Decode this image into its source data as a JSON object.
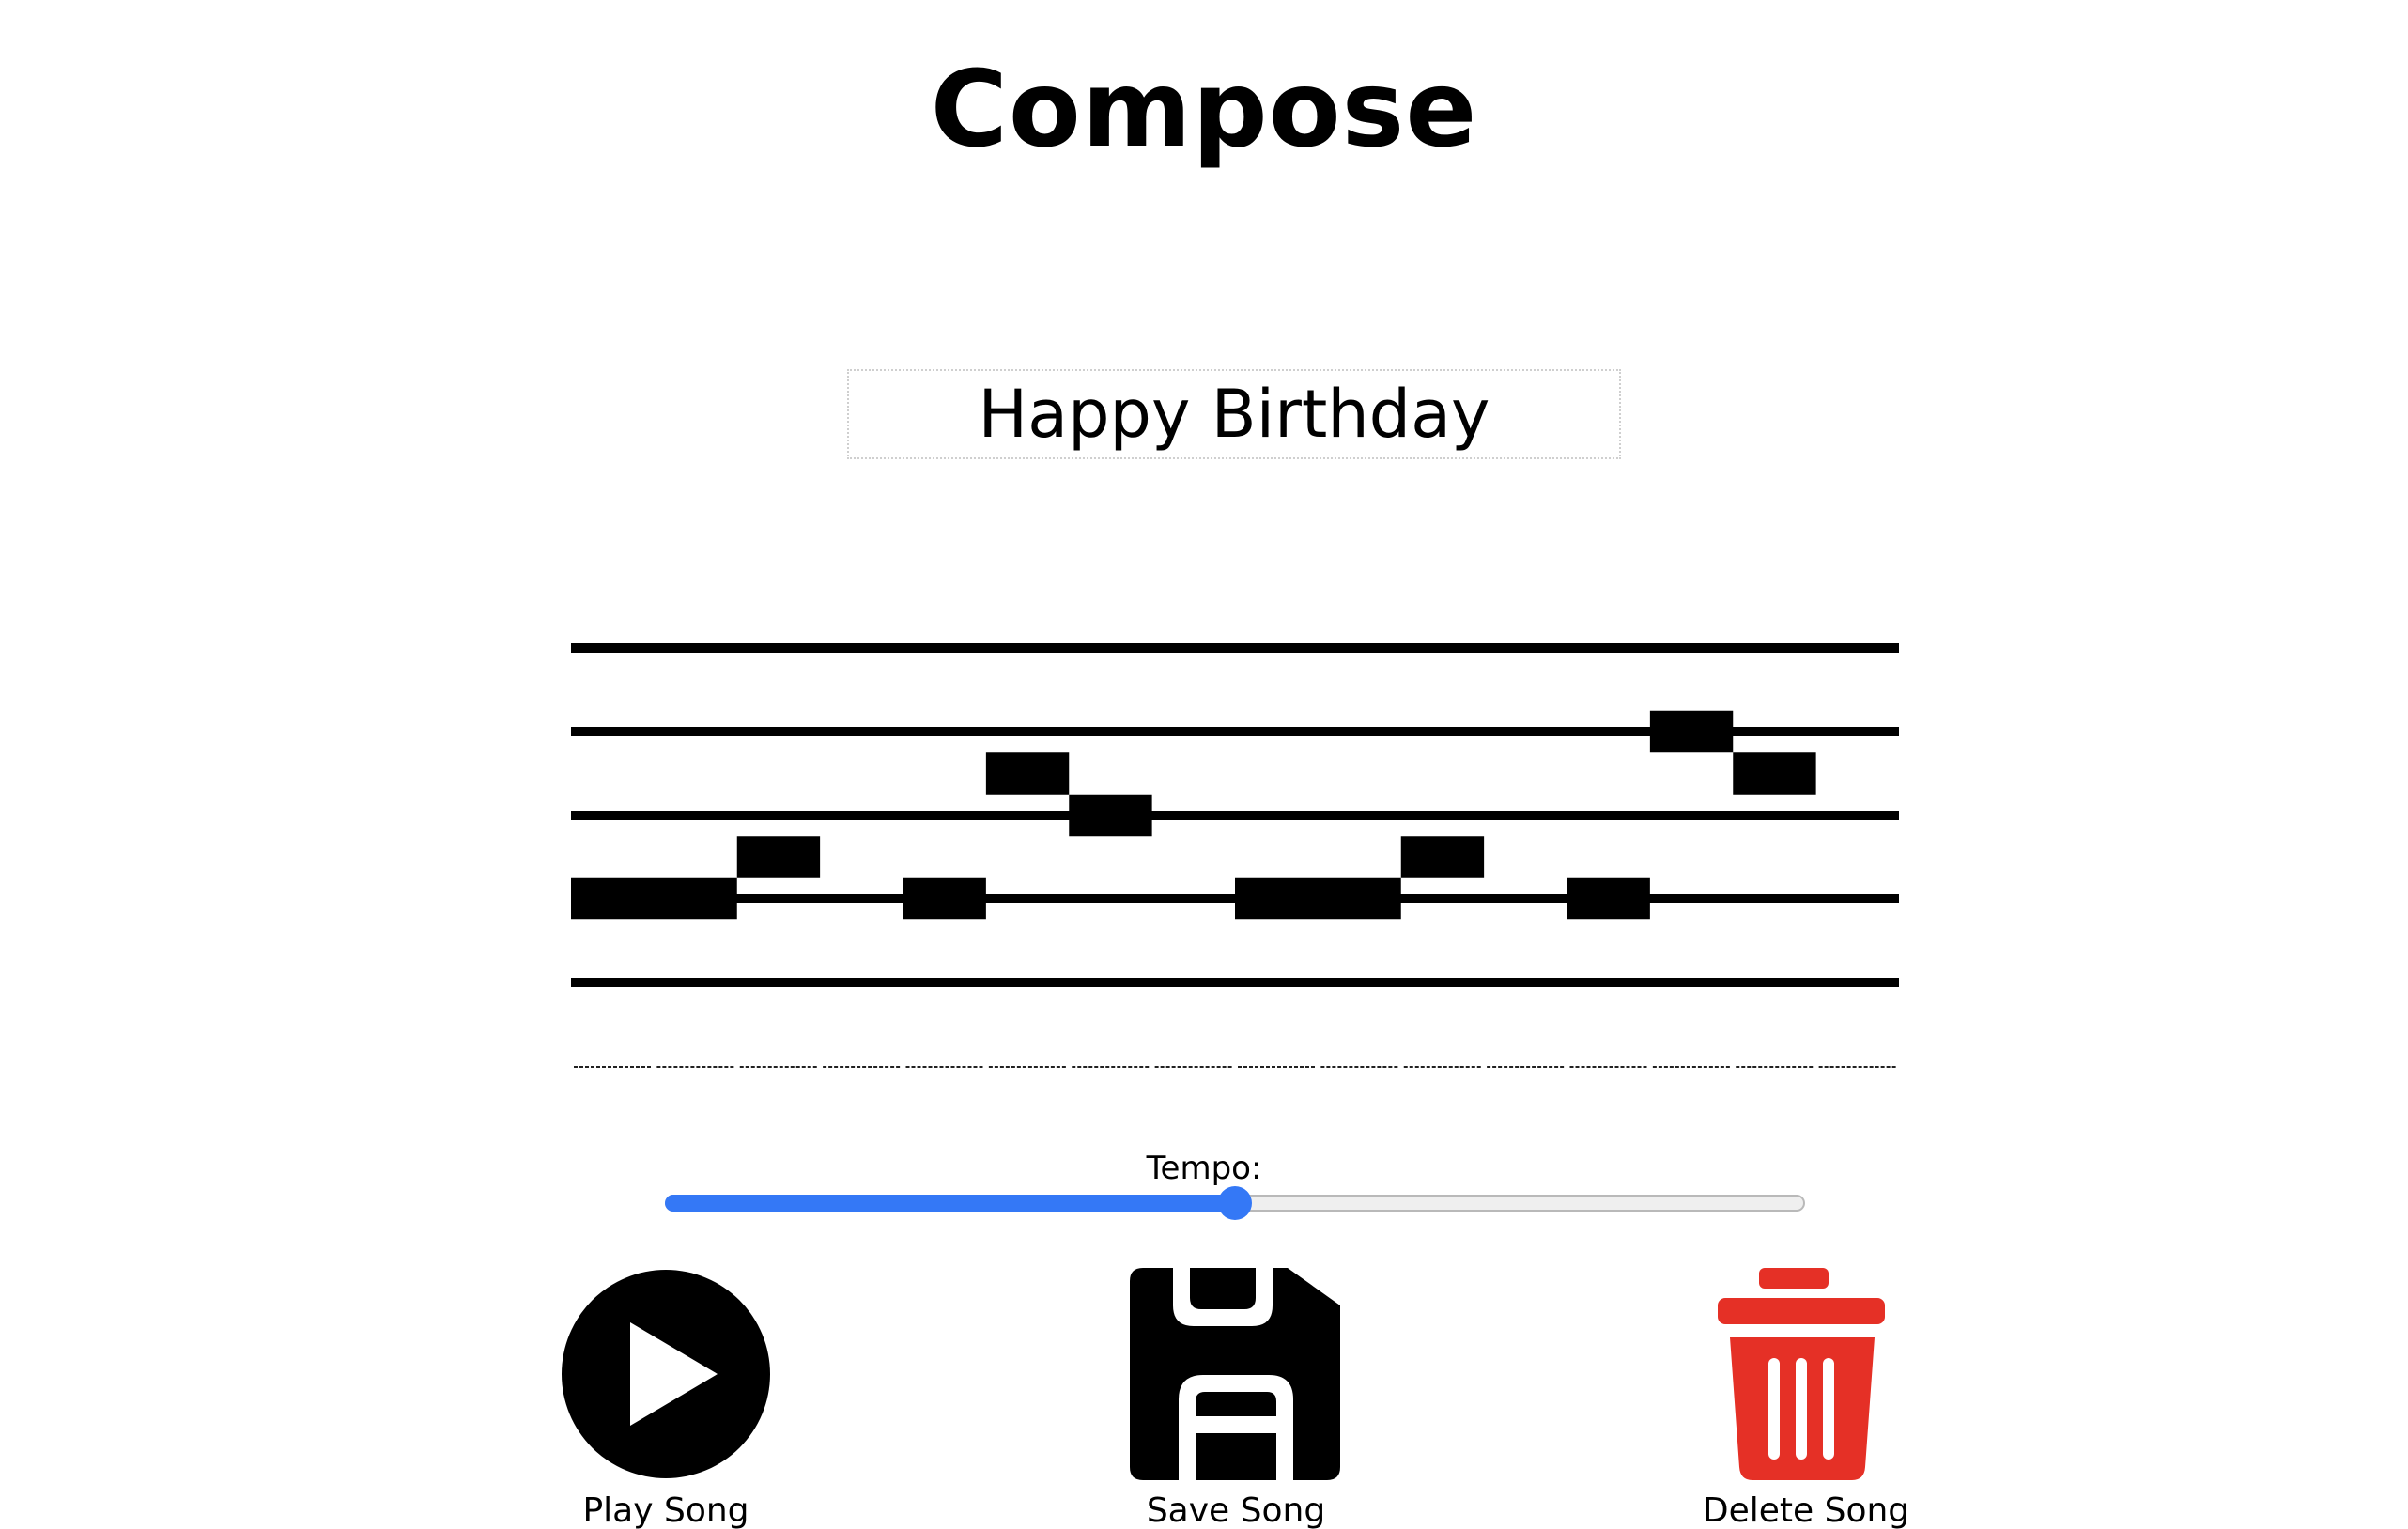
{
  "page": {
    "title": "Compose"
  },
  "song": {
    "name": "Happy Birthday"
  },
  "staff": {
    "line_count": 5,
    "beat_count": 16,
    "notes": [
      {
        "beat": 0,
        "length": 2,
        "step": 3
      },
      {
        "beat": 2,
        "length": 1,
        "step": 2.5
      },
      {
        "beat": 4,
        "length": 1,
        "step": 3
      },
      {
        "beat": 5,
        "length": 1,
        "step": 1.5
      },
      {
        "beat": 6,
        "length": 1,
        "step": 2
      },
      {
        "beat": 8,
        "length": 2,
        "step": 3
      },
      {
        "beat": 10,
        "length": 1,
        "step": 2.5
      },
      {
        "beat": 12,
        "length": 1,
        "step": 3
      },
      {
        "beat": 13,
        "length": 1,
        "step": 1
      },
      {
        "beat": 14,
        "length": 1,
        "step": 1.5
      }
    ]
  },
  "tempo": {
    "label": "Tempo:",
    "value": 50,
    "min": 0,
    "max": 100,
    "colors": {
      "fill": "#3478f6",
      "track": "#efefef"
    }
  },
  "actions": {
    "play": {
      "label": "Play Song",
      "icon": "play-circle-icon",
      "color": "#000000"
    },
    "save": {
      "label": "Save Song",
      "icon": "floppy-disk-icon",
      "color": "#000000"
    },
    "delete": {
      "label": "Delete Song",
      "icon": "trash-can-icon",
      "color": "#e53026"
    }
  }
}
